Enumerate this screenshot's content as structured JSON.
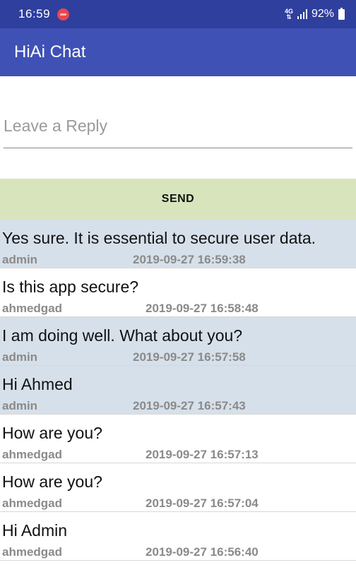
{
  "status_bar": {
    "time": "16:59",
    "network": "4G",
    "battery": "92%",
    "icons": [
      "notification-badge-icon",
      "network-4g-icon",
      "signal-icon",
      "battery-icon"
    ]
  },
  "app_bar": {
    "title": "HiAi Chat",
    "color": "#3f51b5"
  },
  "reply": {
    "placeholder": "Leave a Reply",
    "value": ""
  },
  "send_button": {
    "label": "SEND",
    "color": "#d8e4bc"
  },
  "messages": [
    {
      "text": "Yes sure. It is essential to secure user data.",
      "author": "admin",
      "timestamp": "2019-09-27 16:59:38",
      "kind": "admin"
    },
    {
      "text": "Is this app secure?",
      "author": "ahmedgad",
      "timestamp": "2019-09-27 16:58:48",
      "kind": "user"
    },
    {
      "text": "I am doing well. What about you?",
      "author": "admin",
      "timestamp": "2019-09-27 16:57:58",
      "kind": "admin"
    },
    {
      "text": "Hi Ahmed",
      "author": "admin",
      "timestamp": "2019-09-27 16:57:43",
      "kind": "admin"
    },
    {
      "text": "How are you?",
      "author": "ahmedgad",
      "timestamp": "2019-09-27 16:57:13",
      "kind": "user"
    },
    {
      "text": "How are you?",
      "author": "ahmedgad",
      "timestamp": "2019-09-27 16:57:04",
      "kind": "user"
    },
    {
      "text": "Hi Admin",
      "author": "ahmedgad",
      "timestamp": "2019-09-27 16:56:40",
      "kind": "user"
    }
  ],
  "colors": {
    "status_bar": "#2f3f9e",
    "admin_message_bg": "#d6e0ea",
    "user_message_bg": "#ffffff"
  }
}
